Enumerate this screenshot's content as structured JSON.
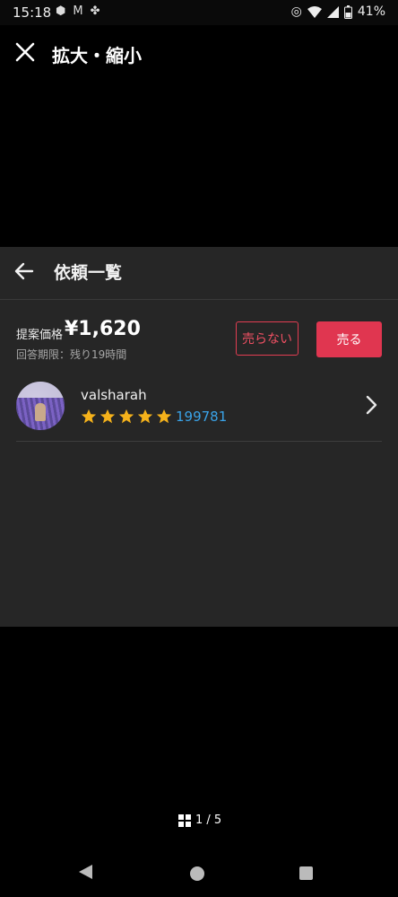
{
  "status_bar": {
    "time": "15:18",
    "battery": "41%",
    "icons_left": [
      "cube-icon",
      "gmail-icon",
      "pinwheel-icon"
    ],
    "icons_right": [
      "target-icon",
      "wifi-icon",
      "signal-icon",
      "battery-icon"
    ]
  },
  "viewer": {
    "title": "拡大・縮小",
    "close_icon": "close-icon"
  },
  "panel": {
    "title": "依頼一覧",
    "price_label": "提案価格",
    "price_value": "¥1,620",
    "deadline": "回答期限：残り19時間",
    "buttons": {
      "no_sell": "売らない",
      "sell": "売る"
    },
    "user": {
      "name": "valsharah",
      "rating_stars": 5,
      "review_count": "199781"
    }
  },
  "pager": {
    "text": "1 / 5"
  },
  "colors": {
    "accent": "#e03650",
    "star": "#f5b21b",
    "link": "#3aa3e8",
    "panel_bg": "#262626"
  }
}
